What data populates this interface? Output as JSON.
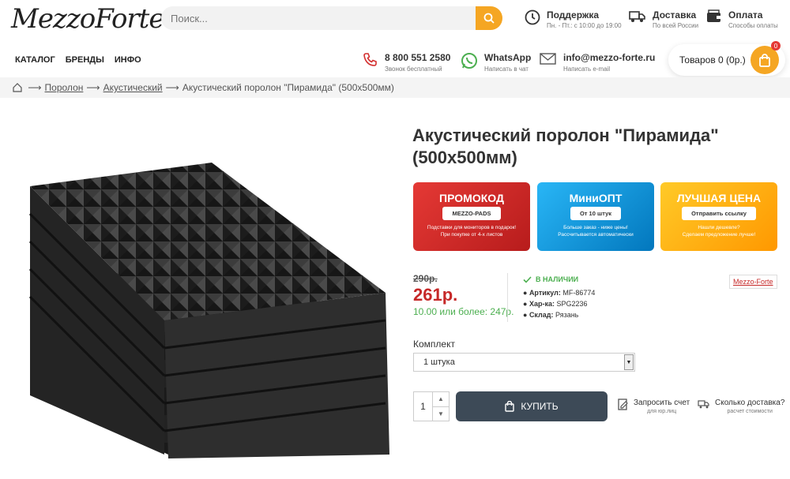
{
  "header": {
    "logo": "MezzoForte",
    "search_placeholder": "Поиск...",
    "support": {
      "title": "Поддержка",
      "sub": "Пн. - Пт.: с 10:00 до 19:00"
    },
    "delivery": {
      "title": "Доставка",
      "sub": "По всей России"
    },
    "payment": {
      "title": "Оплата",
      "sub": "Способы оплаты"
    }
  },
  "nav": [
    "КАТАЛОГ",
    "БРЕНДЫ",
    "ИНФО"
  ],
  "contacts": {
    "phone": {
      "title": "8 800 551 2580",
      "sub": "Звонок бесплатный"
    },
    "whatsapp": {
      "title": "WhatsApp",
      "sub": "Написать в чат"
    },
    "email": {
      "title": "info@mezzo-forte.ru",
      "sub": "Написать e-mail"
    }
  },
  "cart": {
    "label": "Товаров 0 (0р.)",
    "badge": "0"
  },
  "breadcrumb": {
    "items": [
      "Поролон",
      "Акустический"
    ],
    "current": "Акустический поролон \"Пирамида\" (500х500мм)"
  },
  "product": {
    "title_line1": "Акустический поролон \"Пирамида\"",
    "title_line2": "(500х500мм)",
    "old_price": "290р.",
    "price": "261р.",
    "bulk_price": "10.00 или более: 247р.",
    "stock": "В НАЛИЧИИ",
    "sku_label": "Артикул:",
    "sku": "MF-86774",
    "char_label": "Хар-ка:",
    "char": "SPG2236",
    "warehouse_label": "Склад:",
    "warehouse": "Рязань",
    "brand": "Mezzo-Forte"
  },
  "promos": [
    {
      "title": "ПРОМОКОД",
      "pill": "MEZZO-PADS",
      "sub1": "Подставки для мониторов в подарок!",
      "sub2": "При покупке от 4-х листов",
      "color": "#d32f2f"
    },
    {
      "title": "МиниОПТ",
      "pill": "От 10 штук",
      "sub1": "Больше заказ - ниже цены!",
      "sub2": "Рассчитывается автоматически",
      "color": "#1e9ad6"
    },
    {
      "title": "ЛУЧШАЯ ЦЕНА",
      "pill": "Отправить ссылку",
      "sub1": "Нашли дешевле?",
      "sub2": "Сделаем предложение лучше!",
      "color": "#f5b400"
    }
  ],
  "kit": {
    "label": "Комплект",
    "selected": "1 штука"
  },
  "qty": "1",
  "buy_label": "КУПИТЬ",
  "actions": {
    "invoice": {
      "title": "Запросить счет",
      "sub": "для юр.лиц"
    },
    "delivery_cost": {
      "title": "Сколько доставка?",
      "sub": "расчет стоимости"
    }
  }
}
